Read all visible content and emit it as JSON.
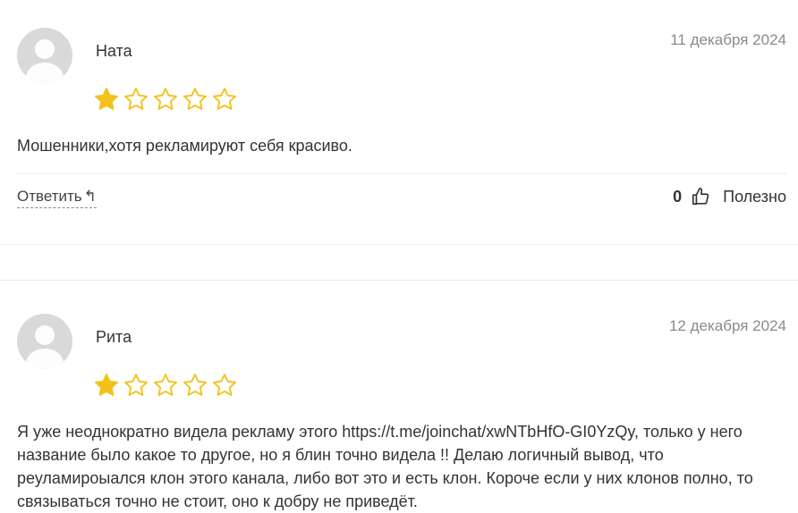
{
  "reviews": [
    {
      "author": "Ната",
      "date": "11 декабря 2024",
      "rating": 1,
      "max_rating": 5,
      "text": "Мошенники,хотя рекламируют себя красиво.",
      "reply_label": "Ответить",
      "helpful_count": "0",
      "helpful_label": "Полезно"
    },
    {
      "author": "Рита",
      "date": "12 декабря 2024",
      "rating": 1,
      "max_rating": 5,
      "text": "Я уже неоднократно видела рекламу этого https://t.me/joinchat/xwNTbHfO-GI0YzQy, только у него название было какое то другое, но я блин точно видела !! Делаю логичный вывод, что реуламироыался клон этого канала, либо вот это и есть клон. Короче если у них клонов полно, то связываться точно не стоит, оно к добру не приведёт."
    }
  ],
  "colors": {
    "star_filled": "#F2C21B",
    "star_outline": "#F2C21B",
    "divider": "#EBEBEB",
    "date": "#8A8A8A"
  },
  "icons": [
    "avatar-placeholder",
    "star-filled-icon",
    "star-outline-icon",
    "reply-arrow-icon",
    "thumbs-up-icon"
  ]
}
